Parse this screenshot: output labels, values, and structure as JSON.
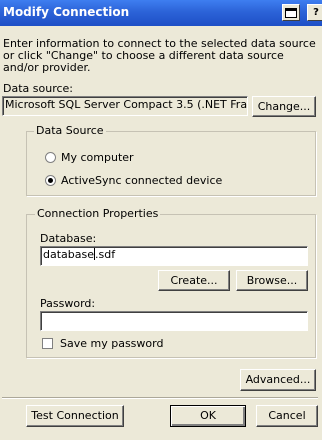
{
  "window": {
    "title": "Modify Connection",
    "buttons": [
      {
        "icon": "window-icon"
      },
      {
        "label": "?"
      }
    ]
  },
  "intro_text": "Enter information to connect to the selected data source or click \"Change\" to choose a different data source and/or provider.",
  "data_source": {
    "label": "Data source:",
    "value": "Microsoft SQL Server Compact 3.5 (.NET Fra",
    "change_button": "Change..."
  },
  "data_source_group": {
    "legend": "Data Source",
    "options": [
      {
        "label": "My computer",
        "selected": false
      },
      {
        "label": "ActiveSync connected device",
        "selected": true
      }
    ]
  },
  "connection_properties": {
    "legend": "Connection Properties",
    "database_label": "Database:",
    "database_value_before_caret": "database",
    "database_value_after_caret": ".sdf",
    "create_button": "Create...",
    "browse_button": "Browse...",
    "password_label": "Password:",
    "password_value": "",
    "save_password_label": "Save my password",
    "save_password_checked": false
  },
  "advanced_button": "Advanced...",
  "footer": {
    "test_connection": "Test Connection",
    "ok": "OK",
    "cancel": "Cancel"
  }
}
